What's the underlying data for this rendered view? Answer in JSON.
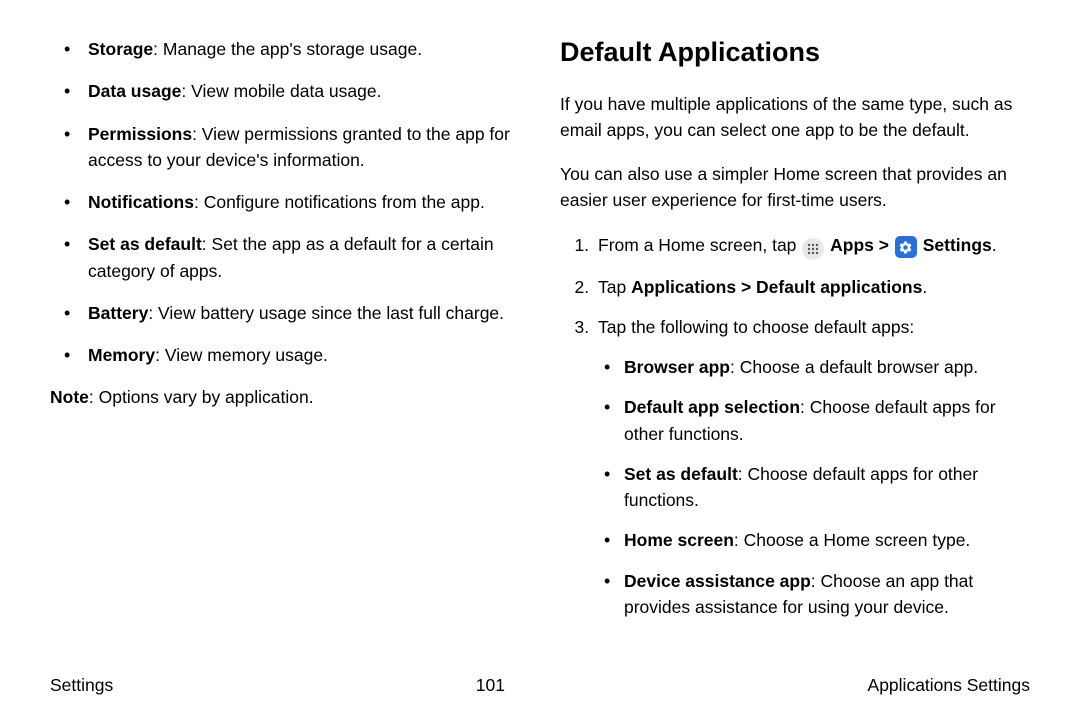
{
  "left": {
    "bullets": [
      {
        "term": "Storage",
        "desc": ": Manage the app's storage usage."
      },
      {
        "term": "Data usage",
        "desc": ": View mobile data usage."
      },
      {
        "term": "Permissions",
        "desc": ": View permissions granted to the app for access to your device's information."
      },
      {
        "term": "Notifications",
        "desc": ": Configure notifications from the app."
      },
      {
        "term": "Set as default",
        "desc": ": Set the app as a default for a certain category of apps."
      },
      {
        "term": "Battery",
        "desc": ": View battery usage since the last full charge."
      },
      {
        "term": "Memory",
        "desc": ": View memory usage."
      }
    ],
    "note_term": "Note",
    "note_desc": ": Options vary by application."
  },
  "right": {
    "heading": "Default Applications",
    "para1": "If you have multiple applications of the same type, such as email apps, you can select one app to be the default.",
    "para2": "You can also use a simpler Home screen that provides an easier user experience for first-time users.",
    "step1_prefix": "From a Home screen, tap ",
    "step1_apps": "Apps",
    "step1_sep": " > ",
    "step1_settings": "Settings",
    "step1_suffix": ".",
    "step2_prefix": "Tap ",
    "step2_bold": "Applications > Default applications",
    "step2_suffix": ".",
    "step3": "Tap the following to choose default apps:",
    "sublist": [
      {
        "term": "Browser app",
        "desc": ": Choose a default browser app."
      },
      {
        "term": "Default app selection",
        "desc": ": Choose default apps for other functions."
      },
      {
        "term": "Set as default",
        "desc": ": Choose default apps for other functions."
      },
      {
        "term": "Home screen",
        "desc": ": Choose a Home screen type."
      },
      {
        "term": "Device assistance app",
        "desc": ": Choose an app that provides assistance for using your device."
      }
    ]
  },
  "footer": {
    "left": "Settings",
    "center": "101",
    "right": "Applications Settings"
  }
}
